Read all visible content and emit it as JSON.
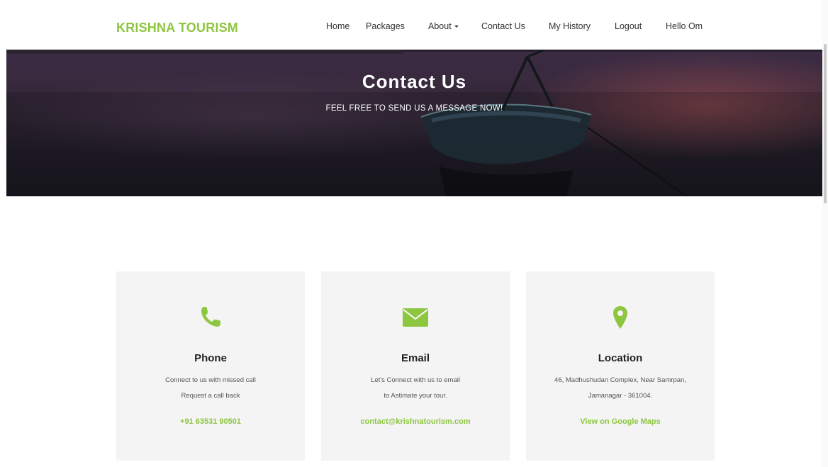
{
  "brand": "KRISHNA TOURISM",
  "nav": {
    "home": "Home",
    "packages": "Packages",
    "about": "About",
    "contact": "Contact Us",
    "history": "My History",
    "logout": "Logout",
    "greeting": "Hello Om"
  },
  "hero": {
    "title": "Contact Us",
    "subtitle": "FEEL FREE TO SEND US A MESSAGE NOW!"
  },
  "cards": [
    {
      "icon": "phone-icon",
      "title": "Phone",
      "line1": "Connect to us with missed call",
      "line2": "Request a call back",
      "link": "+91 63531 90501"
    },
    {
      "icon": "envelope-icon",
      "title": "Email",
      "line1": "Let's Connect with us to email",
      "line2": "to Astimate your tour.",
      "link": "contact@krishnatourism.com"
    },
    {
      "icon": "map-pin-icon",
      "title": "Location",
      "line1": "46, Madhushudan Complex, Near Samrpan,",
      "line2": "Jamanagar - 361004.",
      "link": "View on Google Maps"
    }
  ],
  "colors": {
    "accent": "#8dc63f",
    "card_bg": "#f4f4f4",
    "text": "#333333"
  }
}
